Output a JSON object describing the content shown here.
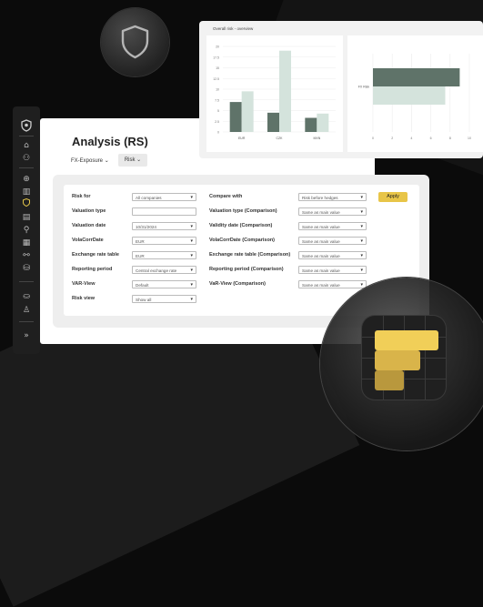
{
  "app": {
    "title": "Analysis (RS)",
    "fx_label": "FX-Exposure",
    "risk_tab": "Risk"
  },
  "sidebar": {
    "icons": [
      "logo-icon",
      "home-icon",
      "users-icon",
      "globe-icon",
      "bar-chart-icon",
      "shield-icon",
      "document-icon",
      "search-icon",
      "calculator-icon",
      "network-icon",
      "database-icon",
      "storage-icon",
      "user-icon",
      "expand-icon"
    ]
  },
  "form": {
    "left": [
      {
        "label": "Risk for",
        "value": "All companies"
      },
      {
        "label": "Valuation type",
        "value": ""
      },
      {
        "label": "Valuation date",
        "value": "10/31/2024"
      },
      {
        "label": "VolaCorrDate",
        "value": "EUR"
      },
      {
        "label": "Exchange rate table",
        "value": "EUR"
      },
      {
        "label": "Reporting period",
        "value": "Central exchange rate"
      },
      {
        "label": "VAR-View",
        "value": "Default"
      },
      {
        "label": "Risk view",
        "value": "Show all"
      }
    ],
    "right": [
      {
        "label": "Compare with",
        "value": "Risk before hedges"
      },
      {
        "label": "Valuation type (Comparison)",
        "value": "Same as main value"
      },
      {
        "label": "Validity date (Comparison)",
        "value": "Same as main value"
      },
      {
        "label": "VolaCorrDate (Comparison)",
        "value": "Same as main value"
      },
      {
        "label": "Exchange rate table (Comparison)",
        "value": "Same as main value"
      },
      {
        "label": "Reporting period (Comparison)",
        "value": "Same as main value"
      },
      {
        "label": "VaR-View (Comparison)",
        "value": "Same as main value"
      }
    ],
    "apply_label": "Apply"
  },
  "chart_card": {
    "title": "Overall risk - overview"
  },
  "chart_data": [
    {
      "type": "bar",
      "categories": [
        "EUR",
        "CZK",
        "MXN"
      ],
      "series": [
        {
          "values": [
            7,
            4.5,
            3.3
          ]
        },
        {
          "values": [
            9.5,
            19,
            4.3
          ]
        }
      ],
      "ylim": [
        0,
        20
      ],
      "yticks": [
        0,
        2.5,
        5,
        7.5,
        10,
        12.5,
        15,
        17.5,
        20
      ],
      "colors": [
        "#5f7369",
        "#d4e3dc"
      ]
    },
    {
      "type": "bar",
      "orientation": "horizontal",
      "categories": [
        "FX Risk"
      ],
      "series": [
        {
          "values": [
            9
          ]
        },
        {
          "values": [
            7.5
          ]
        }
      ],
      "xlim": [
        0,
        10
      ],
      "xticks": [
        0,
        2,
        4,
        6,
        8,
        10
      ],
      "colors": [
        "#5f7369",
        "#d4e3dc"
      ]
    }
  ]
}
